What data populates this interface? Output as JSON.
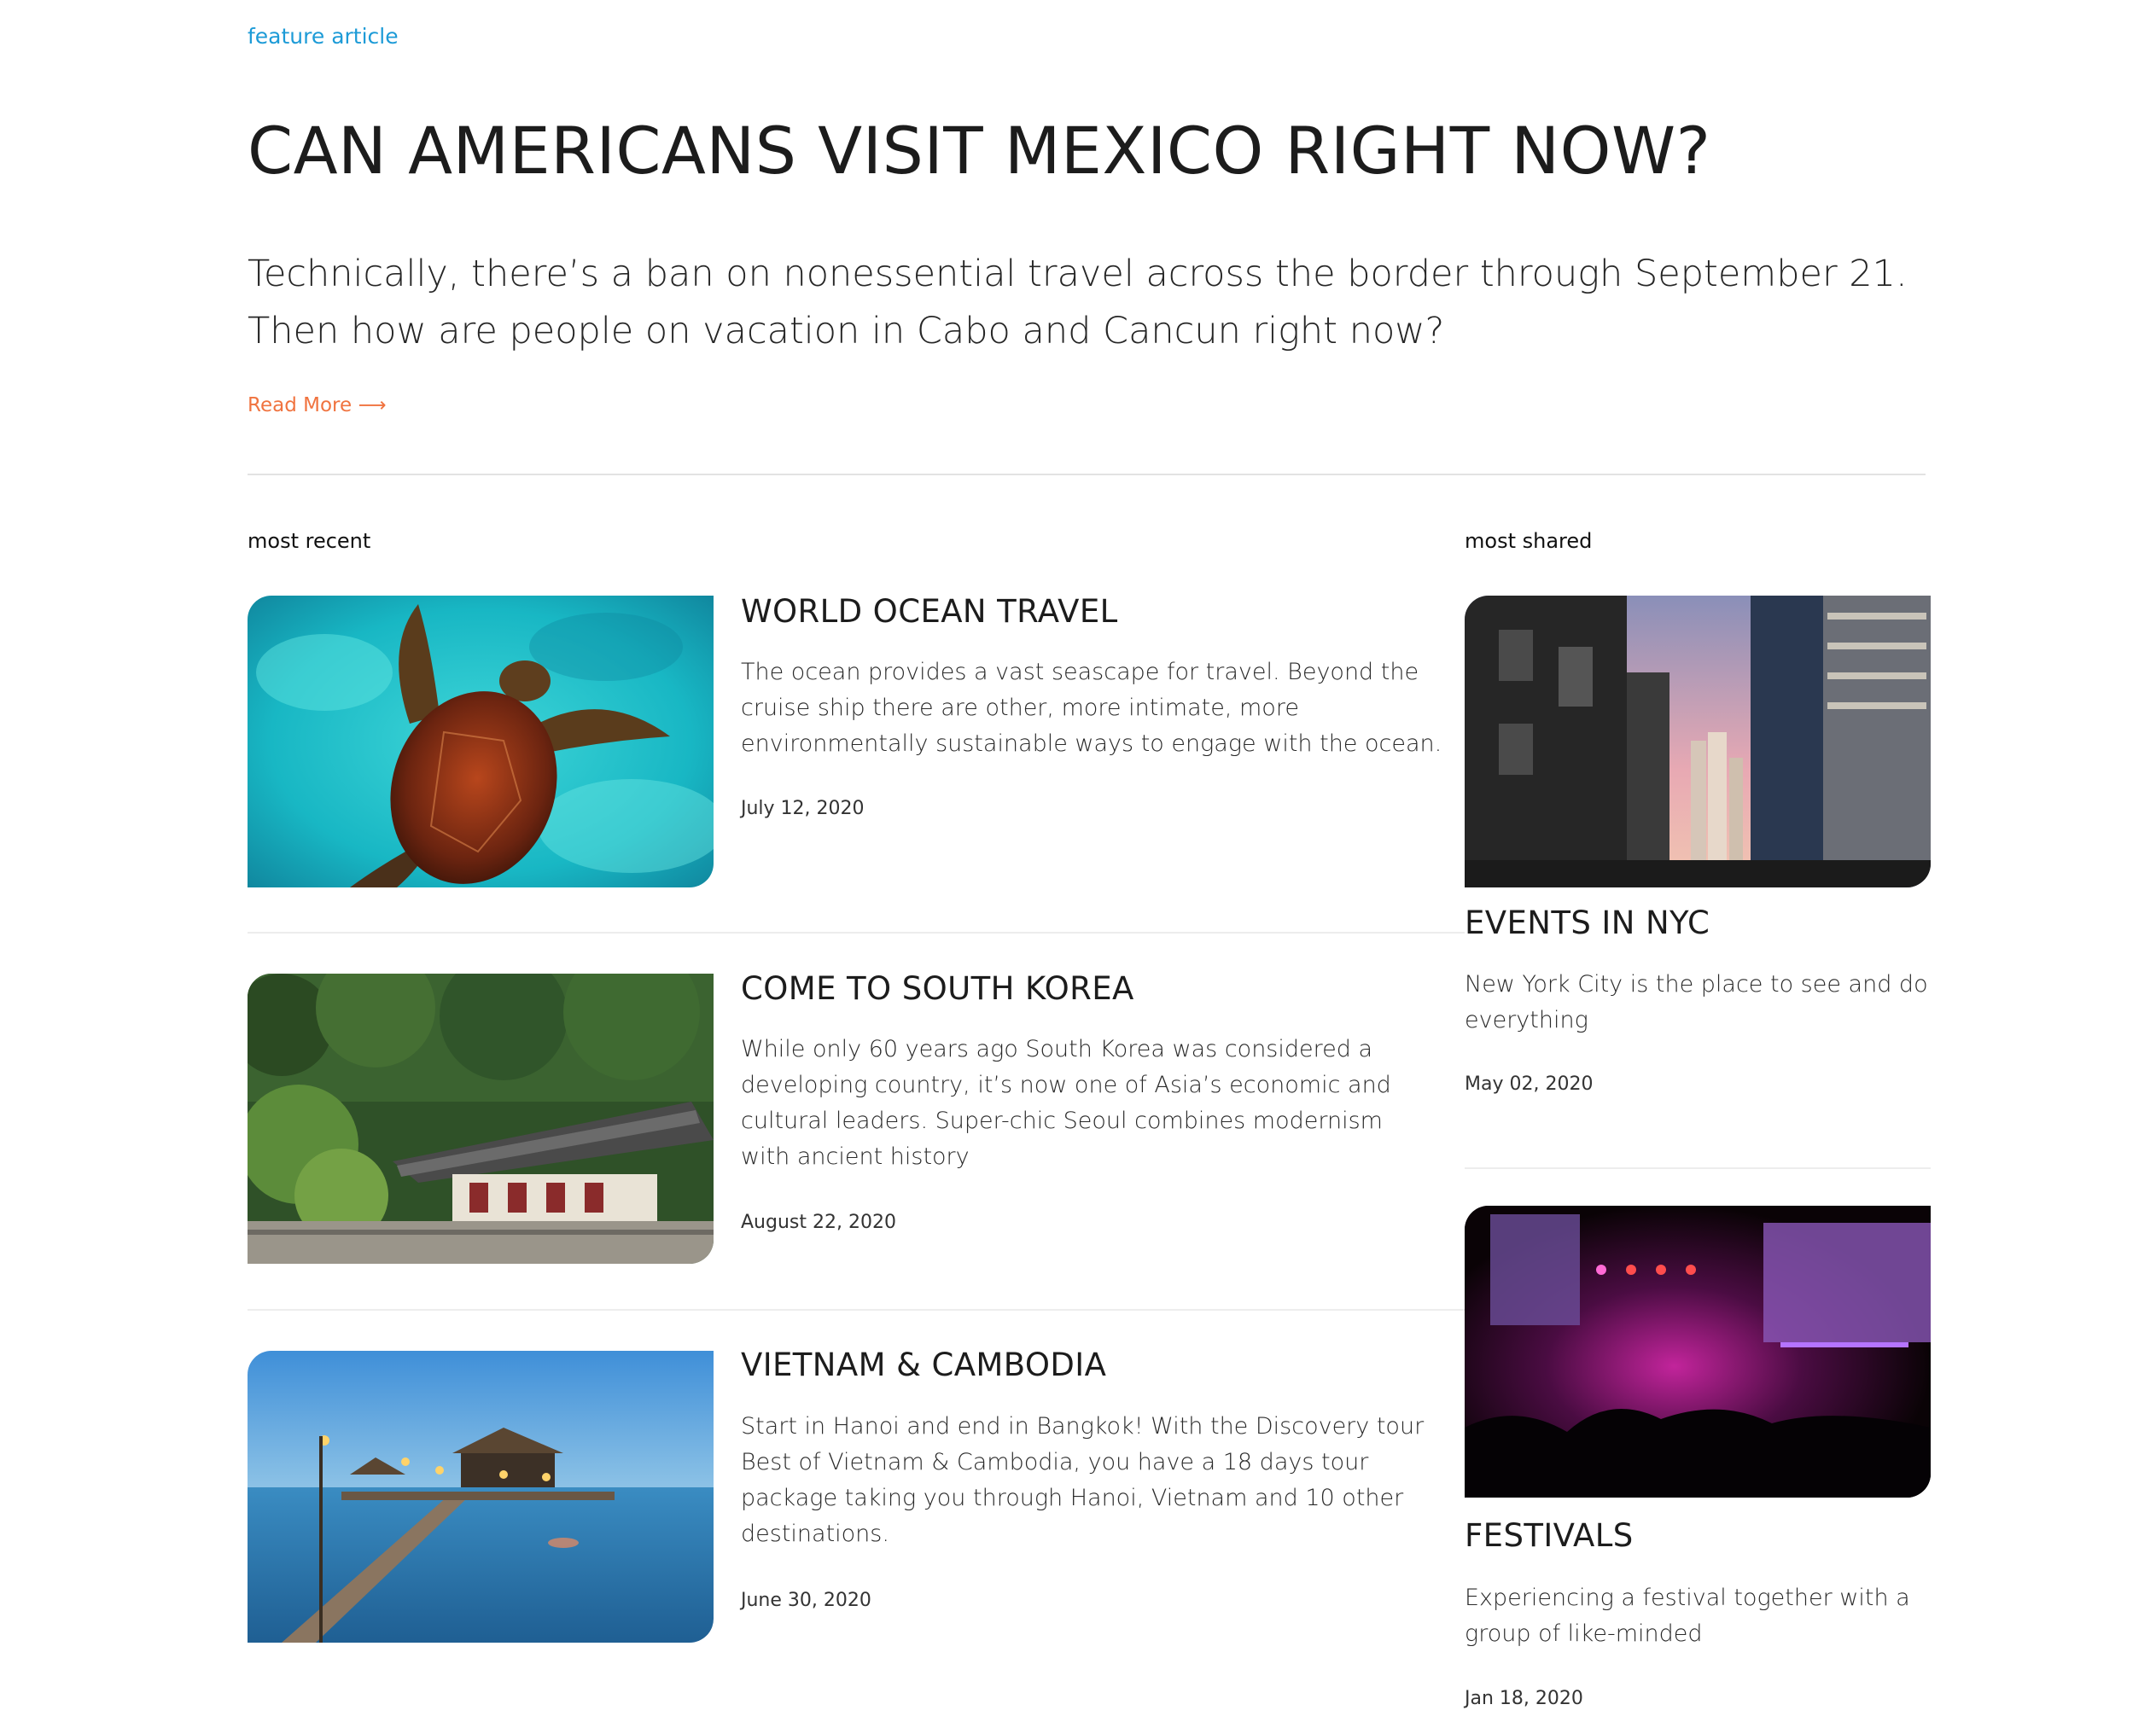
{
  "feature": {
    "kicker": "feature article",
    "title": "CAN AMERICANS VISIT MEXICO RIGHT NOW?",
    "lede": "Technically, there’s a ban on nonessential travel across the border through September 21. Then how are people on vacation in Cabo and Cancun right now?",
    "read_more": "Read More",
    "read_more_icon": "arrow-right-icon"
  },
  "most_recent": {
    "label": "most recent",
    "items": [
      {
        "title": "WORLD OCEAN TRAVEL",
        "text": "The ocean provides a vast seascape for travel. Beyond the cruise ship there are other, more intimate, more environmentally sustainable ways to engage with the ocean.",
        "date": "July 12, 2020",
        "image": "sea-turtle-image"
      },
      {
        "title": "COME TO SOUTH KOREA",
        "text": "While only 60 years ago South Korea was considered a developing country, it’s now one of Asia’s economic and cultural leaders. Super-chic Seoul combines modernism with ancient history",
        "date": "August 22, 2020",
        "image": "korean-temple-image"
      },
      {
        "title": "VIETNAM & CAMBODIA",
        "text": "Start in Hanoi and end in Bangkok! With the Discovery tour Best of Vietnam & Cambodia, you have a 18 days tour package taking you through Hanoi, Vietnam and 10 other destinations.",
        "date": "June 30, 2020",
        "image": "pier-image"
      }
    ]
  },
  "most_shared": {
    "label": "most shared",
    "items": [
      {
        "title": "EVENTS IN NYC",
        "text": "New York City is the place to see and do everything",
        "date": "May 02, 2020",
        "image": "city-street-image"
      },
      {
        "title": "FESTIVALS",
        "text": "Experiencing a festival together with a group of like-minded",
        "date": "Jan 18, 2020",
        "image": "concert-image"
      }
    ]
  },
  "colors": {
    "kicker": "#1d9bd7",
    "read_more": "#f0733f",
    "divider": "#e2e2e2"
  }
}
